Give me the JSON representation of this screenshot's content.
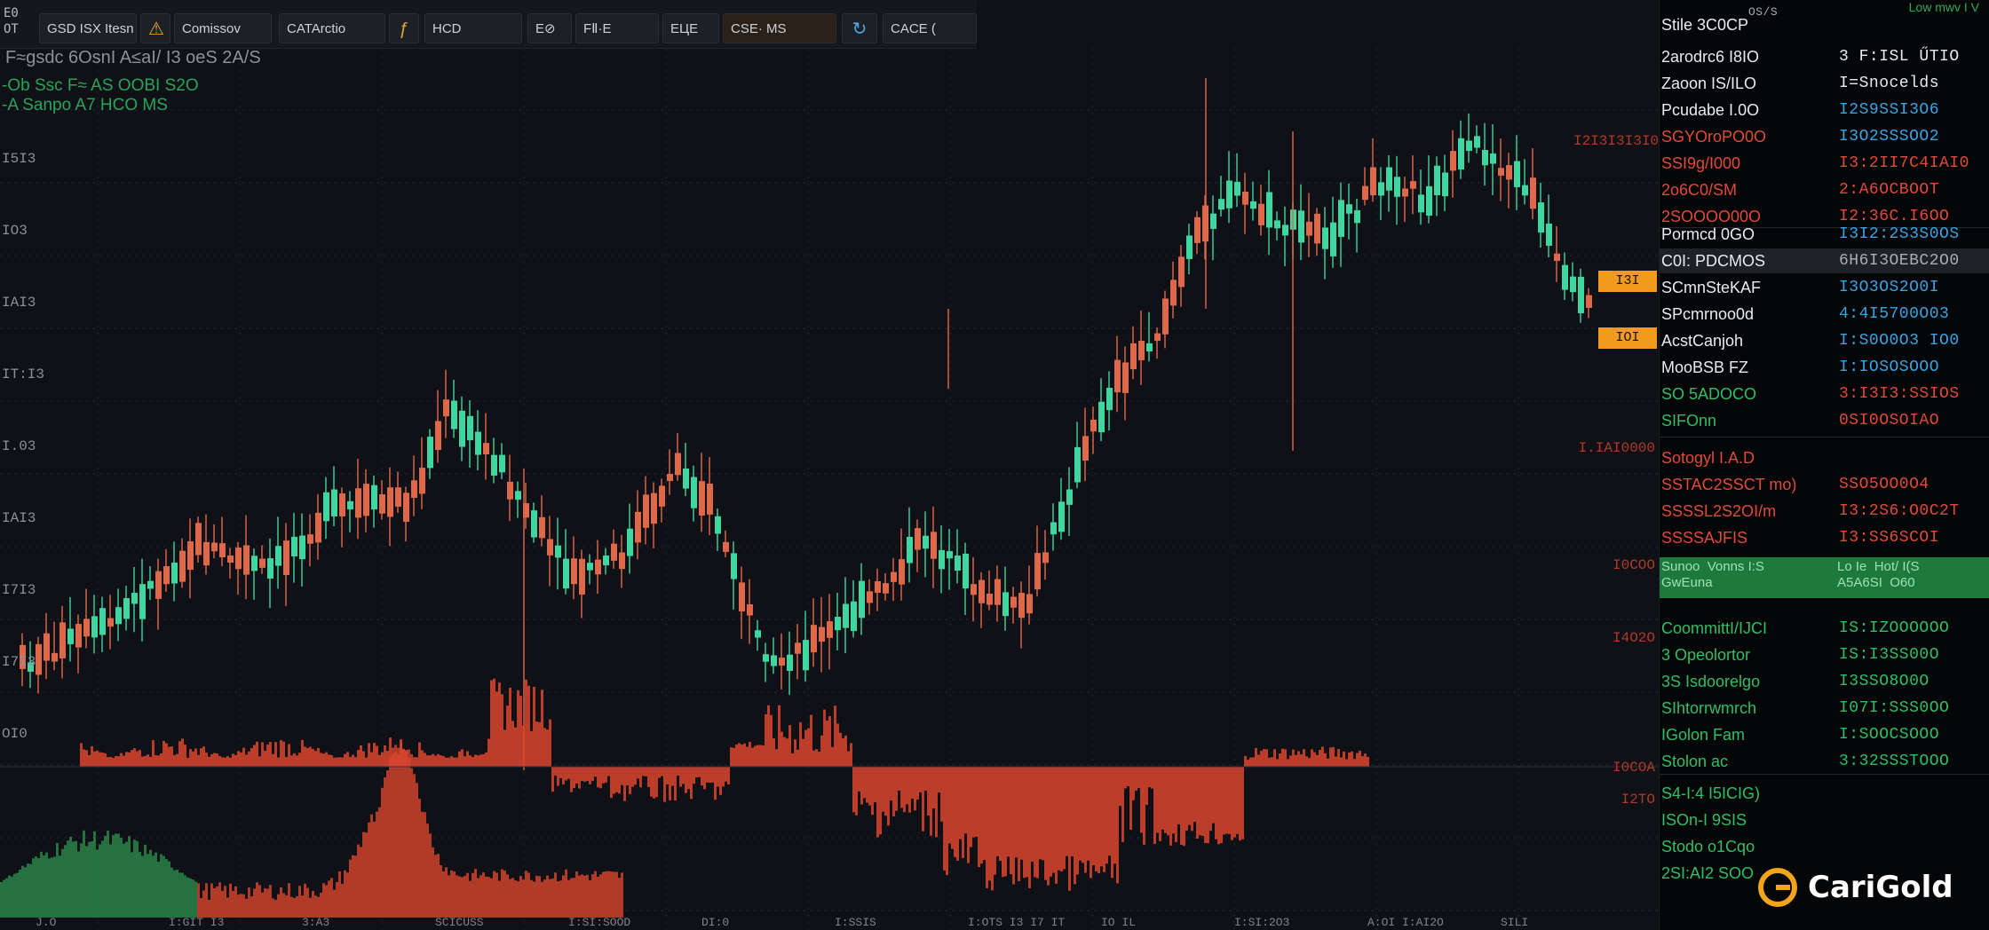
{
  "toolbar": {
    "corner": "E0\nOT",
    "items": [
      {
        "label": "GSD ISX Itesn"
      },
      {
        "label": "",
        "icon": "alert-icon"
      },
      {
        "label": "Comissov"
      },
      {
        "label": "CATArctio"
      },
      {
        "label": "",
        "icon": "indicator-icon"
      },
      {
        "label": "HCD"
      },
      {
        "label": "Ε⊘"
      },
      {
        "label": "FⅡ·E"
      },
      {
        "label": "ЕЦЕ"
      },
      {
        "label": "CSE· MS"
      },
      {
        "label": "",
        "icon": "refresh-icon"
      },
      {
        "label": "CACE  ("
      }
    ]
  },
  "legend": {
    "symbol": "F≈gsdc 6OsnI  A≤aI/ I3 oeS  2A/S",
    "indicator_1": "-Ob Ssc  F≈ AS OOBI S2O",
    "indicator_2": "-A Sanpo A7 HCO MS"
  },
  "axis_labels": {
    "left": [
      "I5I3",
      "IO3",
      "IAI3",
      "IT:I3",
      "I.03",
      "IAI3",
      "I7I3",
      "I7I3",
      "OI0"
    ],
    "right": [
      "I2I3I3I3I0",
      "I.IAI0000",
      "I0COO",
      "I4O2O",
      "I0COA",
      "I2TO"
    ],
    "right_colors": [
      "#b0392a",
      "#b0392a",
      "#b0392a",
      "#b0392a",
      "#b0392a",
      "#b0392a"
    ]
  },
  "price_tags": [
    "I3I",
    "IOI"
  ],
  "right_panel": {
    "top_text": "Low mwv I  V",
    "header": {
      "label": "Stile 3C0CP",
      "value": "OS/S"
    },
    "rows_group1": [
      {
        "label": "2arodrc6 I8IO",
        "value": "3 F:ISL ŰTIO",
        "color": "white"
      },
      {
        "label": "Zaoon IS/ILO",
        "value": "I=Snocelds",
        "color": "white"
      },
      {
        "label": "Pcudabe I.0O",
        "value": "I2S9SSI3O6",
        "color": "blue"
      },
      {
        "label": "SGYOroPO0O",
        "value": "I3O2SSSOO2",
        "color": "blue"
      },
      {
        "label": "SSI9g/I000",
        "value": "I3:2II7C4IAI0",
        "color": "red"
      },
      {
        "label": "2o6C0/SM",
        "value": "2:A6OCBOOT",
        "color": "red"
      },
      {
        "label": "2SOOOO00O",
        "value": "I2:36C.I6OO",
        "color": "red"
      }
    ],
    "rows_group2": [
      {
        "label": "Pormcd 0GO",
        "value": "I3I2:2S3S0OS",
        "color": "blue"
      },
      {
        "label": "C0I: PDCMOS",
        "value": "6H6I3OEBC2O0",
        "color": "gray"
      },
      {
        "label": "SCmnSteKAF",
        "value": "I3O3OS2O0I",
        "color": "blue"
      },
      {
        "label": "SPcmrnoo0d",
        "value": "4:4I5700O03",
        "color": "blue"
      },
      {
        "label": "AcstCanjoh",
        "value": "I:S0O0O3 IO0",
        "color": "blue"
      },
      {
        "label": "MooBSB  FZ",
        "value": "I:IOSOSOOO",
        "color": "blue"
      },
      {
        "label": "SO 5ADOCO",
        "value": "3:I3I3:SSIOS",
        "color": "red"
      },
      {
        "label": "SIFOnn",
        "value": "0SI0OSOIAO",
        "color": "red"
      }
    ],
    "rows_group3": [
      {
        "label": "Sotogyl I.A.D",
        "value": "",
        "color": "red"
      },
      {
        "label": "SSTAC2SSCT mo)",
        "value": "SSO5OO0O4",
        "color": "red"
      },
      {
        "label": "SSSSL2S2OI/m",
        "value": "I3:2S6:O0C2T",
        "color": "red"
      },
      {
        "label": "SSSSAJFIS",
        "value": "I3:SS6SCOI",
        "color": "red"
      }
    ],
    "greenbar": {
      "label": "Sunoo  Vonns I:S\nGwEuna",
      "value": "Lo Ie  Hot/ I(S\nA5A6SI  O60"
    },
    "rows_group4": [
      {
        "label": "CoommittI/IJCI",
        "value": "IS:IZOOOOOO",
        "color": "green"
      },
      {
        "label": "3 Opeolortor",
        "value": "IS:I3SS00O",
        "color": "green"
      },
      {
        "label": "3S Isdoorelgo",
        "value": "I3SSO8O0O",
        "color": "green"
      },
      {
        "label": "SIhtorrwmrch",
        "value": "I07I:SSS0OO",
        "color": "green"
      },
      {
        "label": "IGolon Fam",
        "value": "I:SOOCSOOO",
        "color": "green"
      },
      {
        "label": "Stolon ac",
        "value": "3:32SSSTOOO",
        "color": "green"
      }
    ],
    "rows_group5": [
      {
        "label": "S4-I:4 I5ICIG)",
        "value": "",
        "color": "green"
      },
      {
        "label": "ISOn-I 9SIS",
        "value": "",
        "color": "green"
      },
      {
        "label": "Stodo o1Cqo",
        "value": "",
        "color": "green"
      },
      {
        "label": "2SI:AI2 SOO",
        "value": "",
        "color": "green"
      }
    ]
  },
  "brand": {
    "name": "CariGold"
  },
  "bottom_strip": [
    "J.O",
    "I:GIT I3",
    "3:A3",
    "SCICUSS",
    "I:SI:SOOD",
    "DI:0",
    "I:SSIS",
    "I:OTS I3  I7 IT",
    "IO IL",
    "I:SI:2O3",
    "A:OI   I:AI2O",
    "SILI"
  ],
  "colors": {
    "up": "#3fd6a0",
    "down": "#e0684a",
    "volume": "#d9452e",
    "volume_green": "#2a8a4a",
    "grid": "#22262e"
  },
  "chart_data": {
    "type": "candlestick",
    "note_series": "Price candles with volume histogram below",
    "candles": []
  }
}
